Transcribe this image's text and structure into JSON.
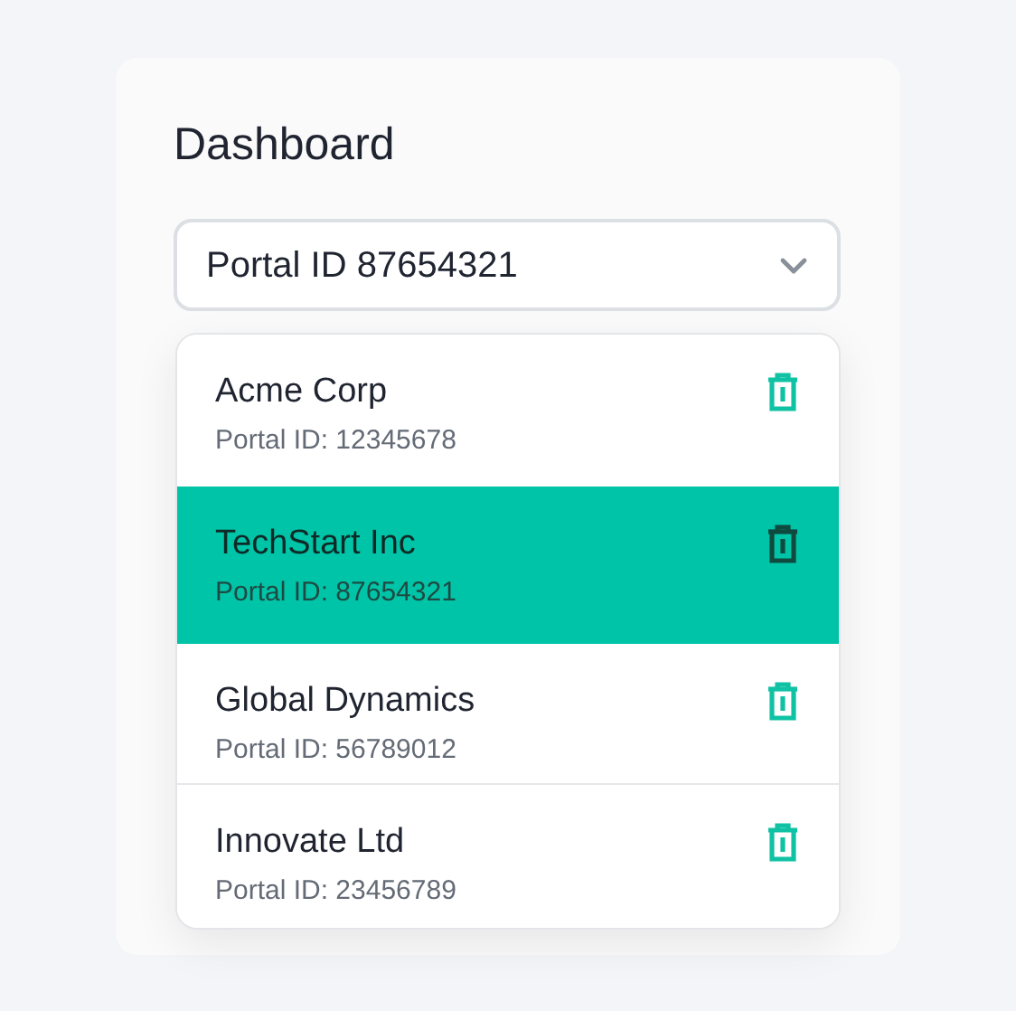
{
  "title": "Dashboard",
  "select": {
    "value": "Portal ID 87654321",
    "expanded": true
  },
  "portals": [
    {
      "name": "Acme Corp",
      "id_text": "Portal ID: 12345678",
      "selected": false
    },
    {
      "name": "TechStart Inc",
      "id_text": "Portal ID: 87654321",
      "selected": true
    },
    {
      "name": "Global Dynamics",
      "id_text": "Portal ID: 56789012",
      "selected": false
    },
    {
      "name": "Innovate Ltd",
      "id_text": "Portal ID: 23456789",
      "selected": false
    }
  ]
}
